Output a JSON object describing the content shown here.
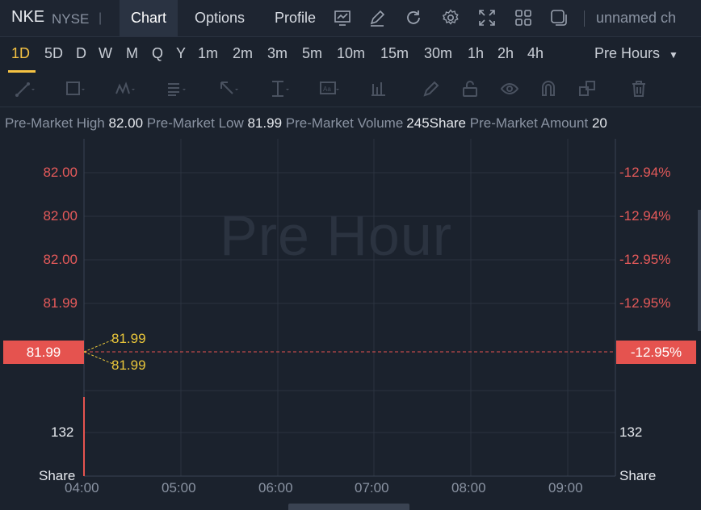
{
  "header": {
    "symbol": "NKE",
    "exchange": "NYSE",
    "separator": "|",
    "tabs": [
      {
        "label": "Chart"
      },
      {
        "label": "Options"
      },
      {
        "label": "Profile"
      }
    ],
    "toolbar_icons": [
      "chart-settings-icon",
      "edit-icon",
      "refresh-icon",
      "gear-icon",
      "expand-icon",
      "grid-layout-icon",
      "copy-icon"
    ],
    "layout_name": "unnamed ch"
  },
  "timeframes": {
    "items": [
      "1D",
      "5D",
      "D",
      "W",
      "M",
      "Q",
      "Y",
      "1m",
      "2m",
      "3m",
      "5m",
      "10m",
      "15m",
      "30m",
      "1h",
      "2h",
      "4h"
    ],
    "active": "1D",
    "session": "Pre Hours"
  },
  "info": {
    "high_label": "Pre-Market High",
    "high_value": "82.00",
    "low_label": "Pre-Market Low",
    "low_value": "81.99",
    "volume_label": "Pre-Market Volume",
    "volume_value": "245Share",
    "amount_label": "Pre-Market Amount",
    "amount_value": "20"
  },
  "chart": {
    "watermark": "Pre Hour",
    "left_axis": [
      "82.00",
      "82.00",
      "82.00",
      "81.99"
    ],
    "right_axis": [
      "-12.94%",
      "-12.94%",
      "-12.95%",
      "-12.95%"
    ],
    "current_price": "81.99",
    "current_change": "-12.95%",
    "tag_high": "81.99",
    "tag_low": "81.99",
    "volume_value": "132",
    "volume_unit": "Share",
    "volume_value_right": "132",
    "volume_unit_right": "Share",
    "x_axis": [
      "04:00",
      "05:00",
      "06:00",
      "07:00",
      "08:00",
      "09:00"
    ]
  }
}
